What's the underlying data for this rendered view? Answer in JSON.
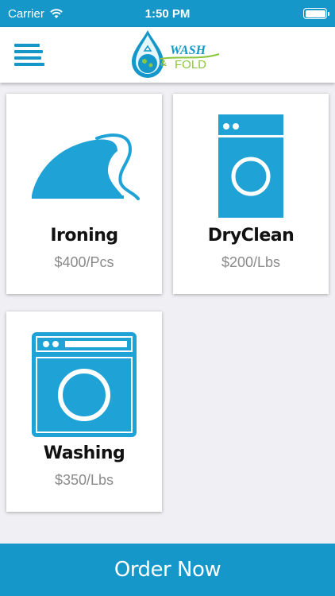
{
  "status_bar": {
    "carrier": "Carrier",
    "time": "1:50 PM"
  },
  "header": {
    "logo_text_top": "WASH",
    "logo_text_mid": "&",
    "logo_text_bottom": "FOLD"
  },
  "services": [
    {
      "title": "Ironing",
      "price": "$400/Pcs",
      "icon": "iron-icon"
    },
    {
      "title": "DryClean",
      "price": "$200/Lbs",
      "icon": "dryclean-machine-icon"
    },
    {
      "title": "Washing",
      "price": "$350/Lbs",
      "icon": "washing-machine-icon"
    }
  ],
  "footer": {
    "order_label": "Order Now"
  },
  "colors": {
    "primary": "#1597c9",
    "background": "#efeff4",
    "logo_green": "#8cc63f"
  }
}
